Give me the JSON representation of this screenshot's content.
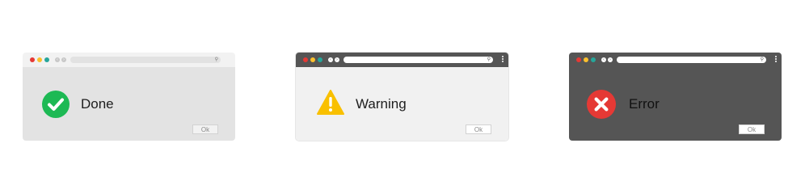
{
  "windows": [
    {
      "theme": "light",
      "message": "Done",
      "icon": "check-circle-icon",
      "icon_color": "#1db954",
      "ok_label": "Ok",
      "traffic_lights": [
        "#e53935",
        "#fbc02d",
        "#26a69a"
      ]
    },
    {
      "theme": "light-gray with dark toolbar",
      "message": "Warning",
      "icon": "warning-triangle-icon",
      "icon_color": "#f9c000",
      "ok_label": "Ok",
      "traffic_lights": [
        "#e53935",
        "#fbc02d",
        "#26a69a"
      ]
    },
    {
      "theme": "dark",
      "message": "Error",
      "icon": "error-x-circle-icon",
      "icon_color": "#e53935",
      "ok_label": "Ok",
      "traffic_lights": [
        "#e53935",
        "#fbc02d",
        "#26a69a"
      ]
    }
  ]
}
